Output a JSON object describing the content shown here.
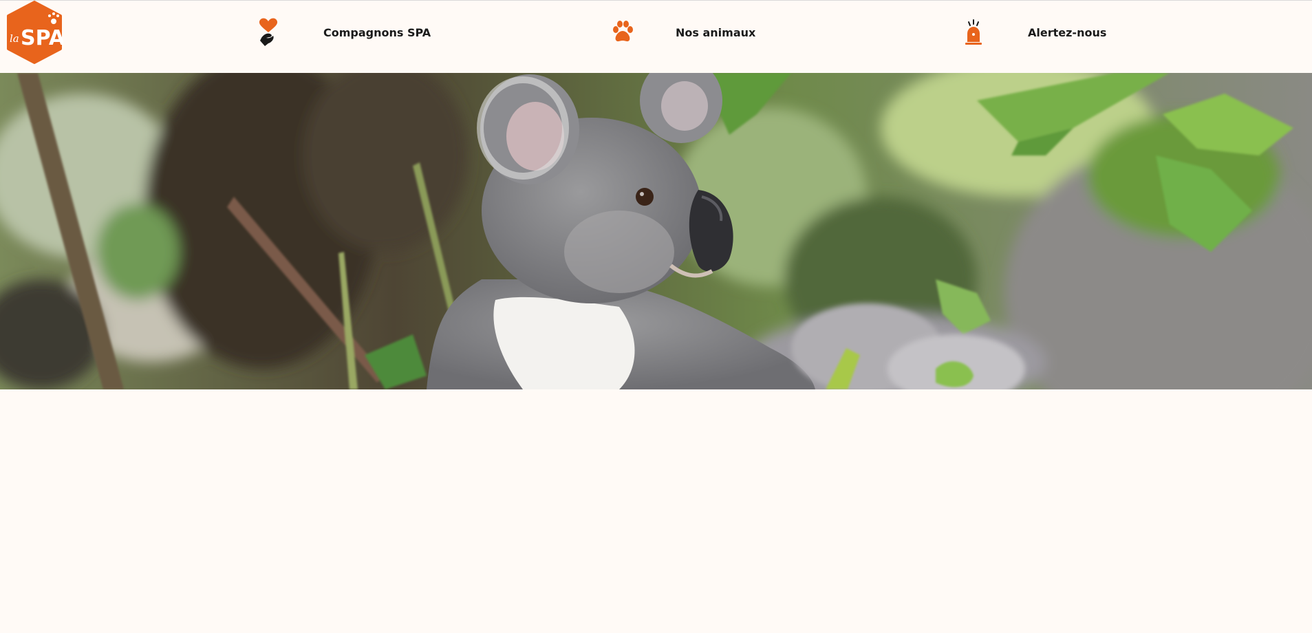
{
  "brand": {
    "logo_text": "la SPA",
    "logo_color": "#e8641c"
  },
  "nav": {
    "items": [
      {
        "label": "Compagnons SPA",
        "icon": "heart-hand-icon"
      },
      {
        "label": "Nos animaux",
        "icon": "paw-icon"
      },
      {
        "label": "Alertez-nous",
        "icon": "alarm-siren-icon"
      }
    ]
  },
  "hero": {
    "subject": "koala-photo"
  },
  "colors": {
    "accent": "#e8641c",
    "background": "#fffaf6",
    "text": "#1a1a1a"
  }
}
